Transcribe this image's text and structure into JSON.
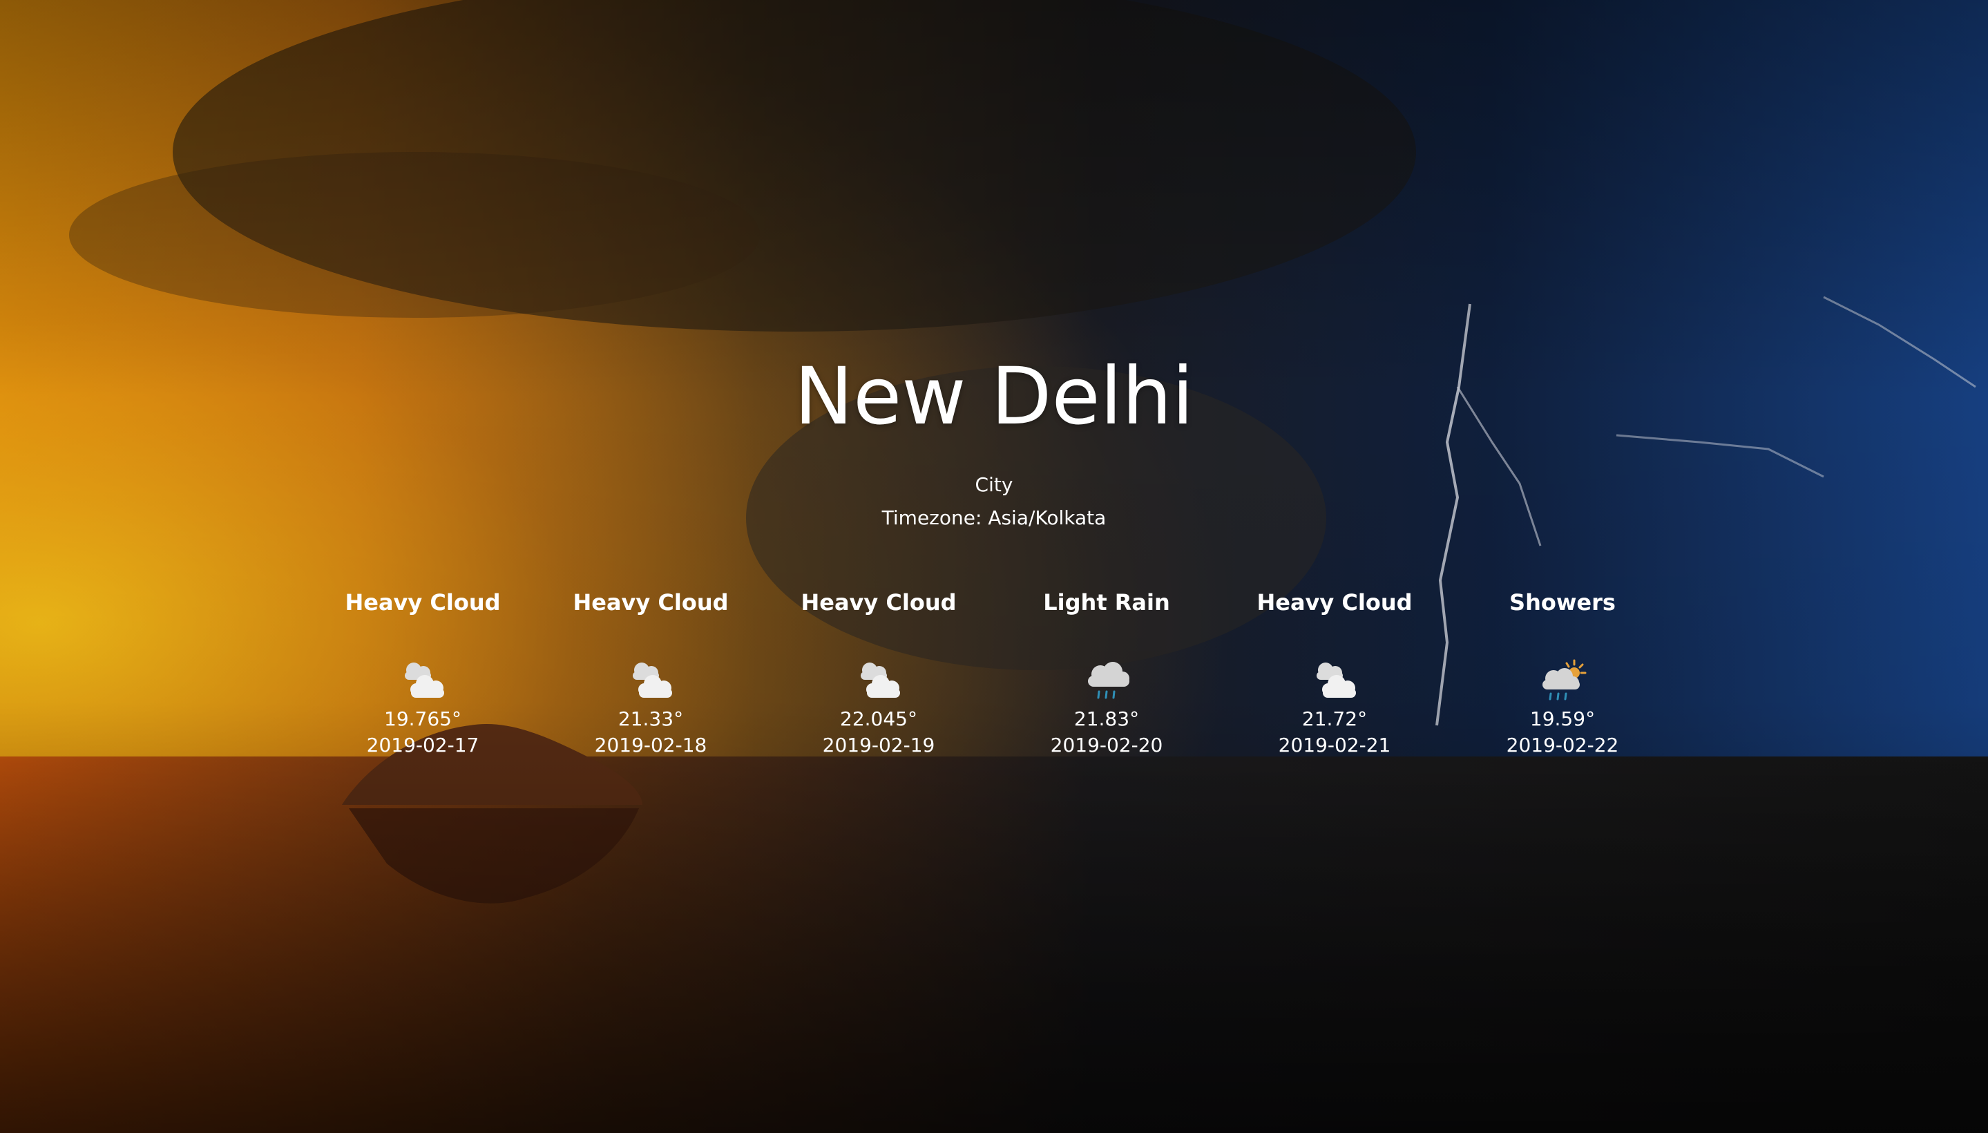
{
  "location": {
    "title": "New Delhi",
    "type": "City",
    "timezone": "Timezone: Asia/Kolkata"
  },
  "forecast": [
    {
      "condition": "Heavy Cloud",
      "icon": "heavy-cloud-icon",
      "temp": "19.765°",
      "date": "2019-02-17"
    },
    {
      "condition": "Heavy Cloud",
      "icon": "heavy-cloud-icon",
      "temp": "21.33°",
      "date": "2019-02-18"
    },
    {
      "condition": "Heavy Cloud",
      "icon": "heavy-cloud-icon",
      "temp": "22.045°",
      "date": "2019-02-19"
    },
    {
      "condition": "Light Rain",
      "icon": "light-rain-icon",
      "temp": "21.83°",
      "date": "2019-02-20"
    },
    {
      "condition": "Heavy Cloud",
      "icon": "heavy-cloud-icon",
      "temp": "21.72°",
      "date": "2019-02-21"
    },
    {
      "condition": "Showers",
      "icon": "showers-icon",
      "temp": "19.59°",
      "date": "2019-02-22"
    }
  ],
  "colors": {
    "text": "#ffffff",
    "cloud": "#d9d9d9",
    "rain": "#2f8fb6",
    "sun": "#e6a13a"
  }
}
